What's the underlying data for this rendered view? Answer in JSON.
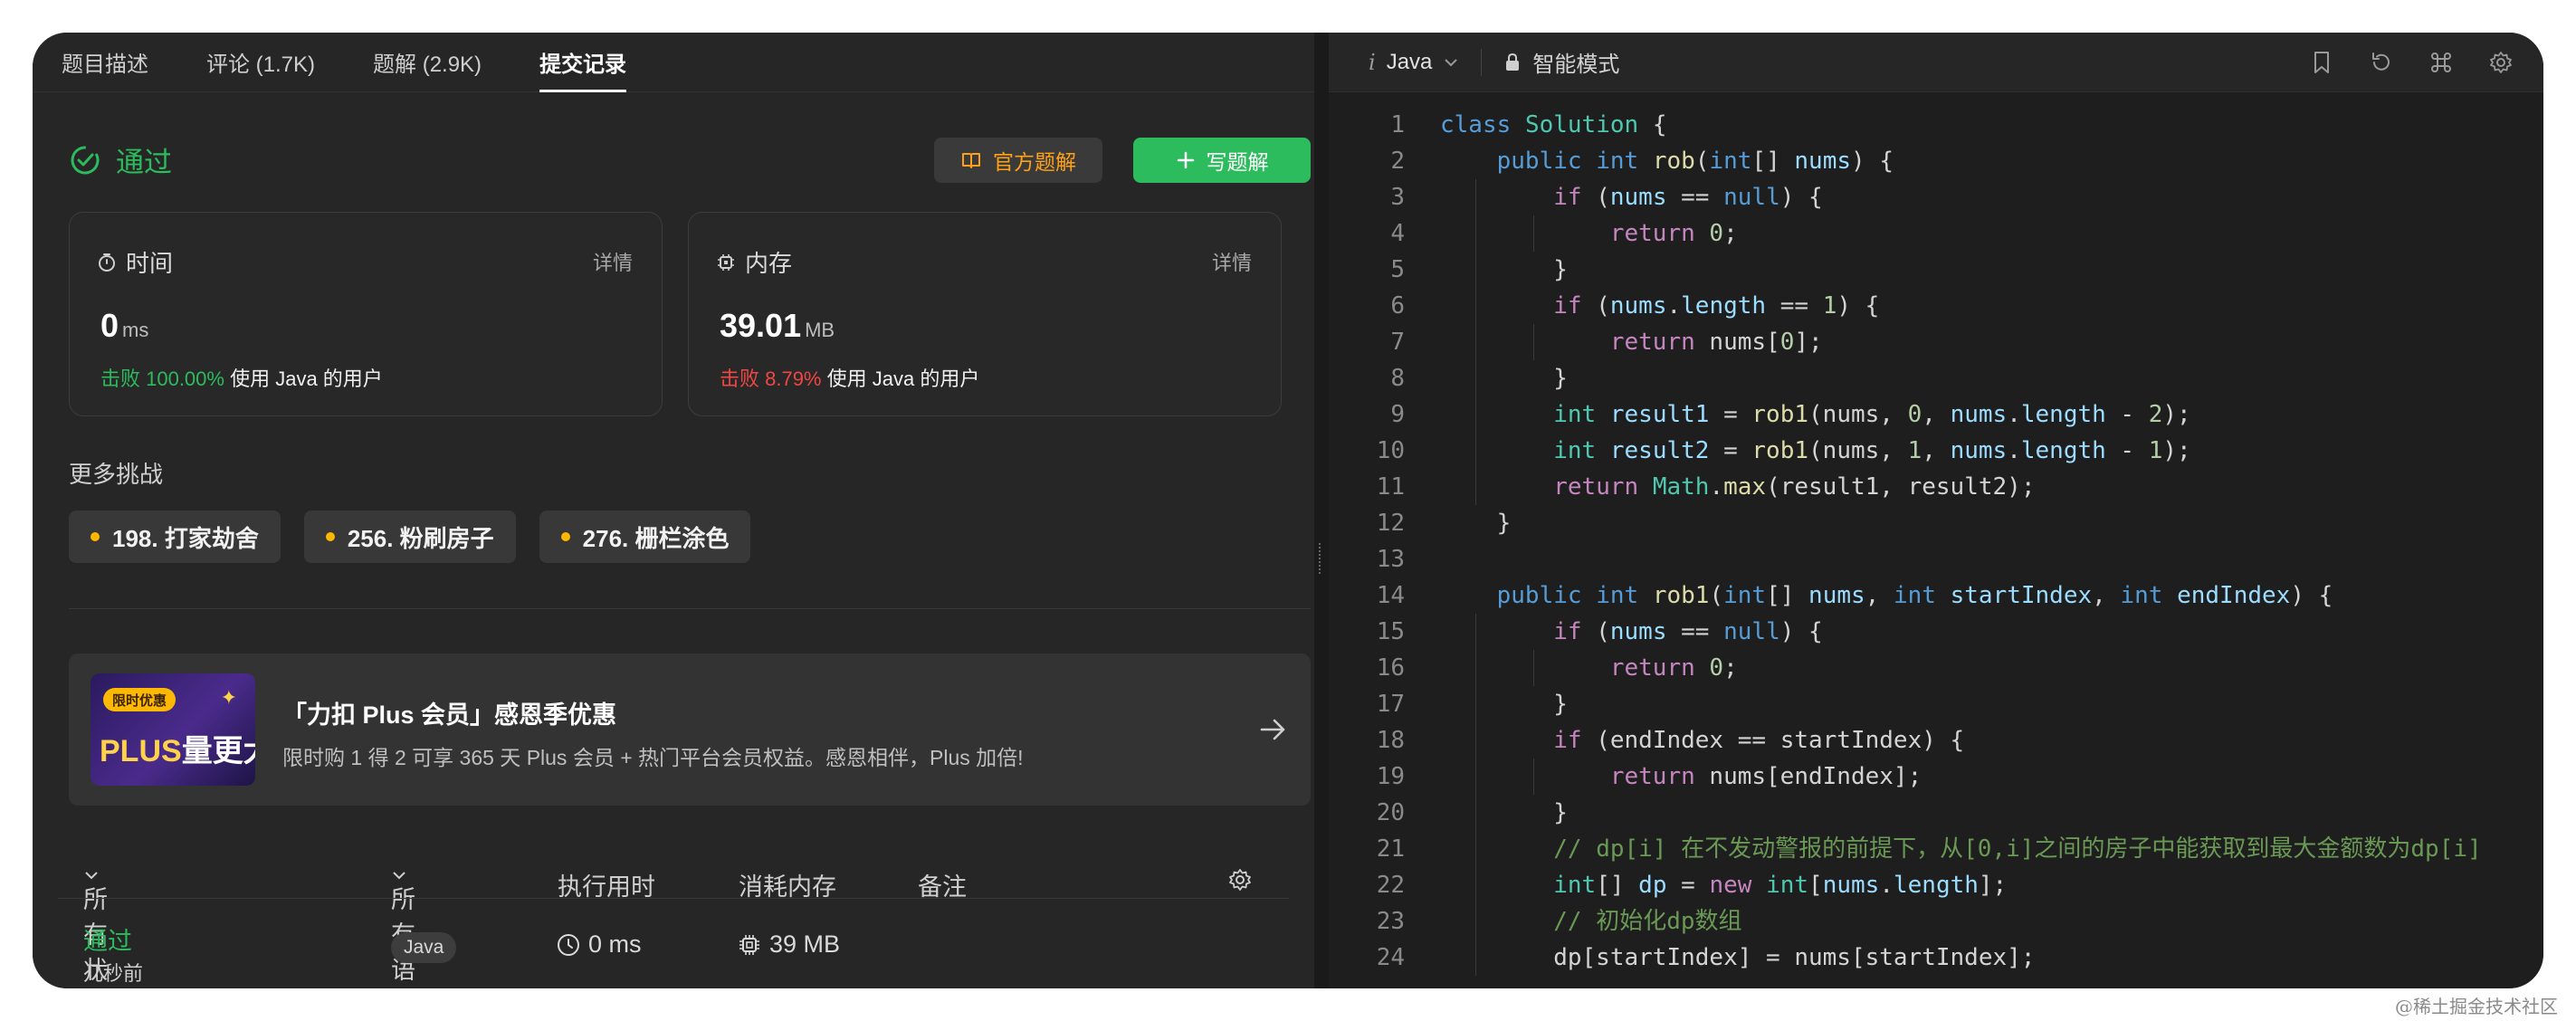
{
  "tabs": [
    "题目描述",
    "评论 (1.7K)",
    "题解 (2.9K)",
    "提交记录"
  ],
  "active_tab": 3,
  "result": {
    "status": "通过",
    "official_solution": "官方题解",
    "write_solution": "写题解"
  },
  "time_card": {
    "title": "时间",
    "detail": "详情",
    "value": "0",
    "unit": "ms",
    "beat": "击败 100.00%",
    "beat_suffix": "使用 Java 的用户"
  },
  "memory_card": {
    "title": "内存",
    "detail": "详情",
    "value": "39.01",
    "unit": "MB",
    "beat": "击败 8.79%",
    "beat_suffix": "使用 Java 的用户"
  },
  "more": {
    "title": "更多挑战",
    "chips": [
      "198. 打家劫舍",
      "256. 粉刷房子",
      "276. 栅栏涂色"
    ]
  },
  "banner": {
    "badge": "限时优惠",
    "plus": "PLUS",
    "plus_rest": "量更大",
    "title": "「力扣 Plus 会员」感恩季优惠",
    "subtitle": "限时购 1 得 2 可享 365 天 Plus 会员 + 热门平台会员权益。感恩相伴，Plus 加倍!"
  },
  "submissions": {
    "headers": [
      "所有状态",
      "所有语言",
      "执行用时",
      "消耗内存",
      "备注"
    ],
    "row": {
      "status": "通过",
      "time_ago": "几秒前",
      "lang": "Java",
      "runtime": "0 ms",
      "memory": "39 MB"
    }
  },
  "editor": {
    "lang": "Java",
    "mode": "智能模式"
  },
  "watermark": "@稀土掘金技术社区",
  "colors": {
    "accent_green": "#2cbb5d",
    "accent_orange": "#ffa116",
    "danger_red": "#ef4743"
  }
}
